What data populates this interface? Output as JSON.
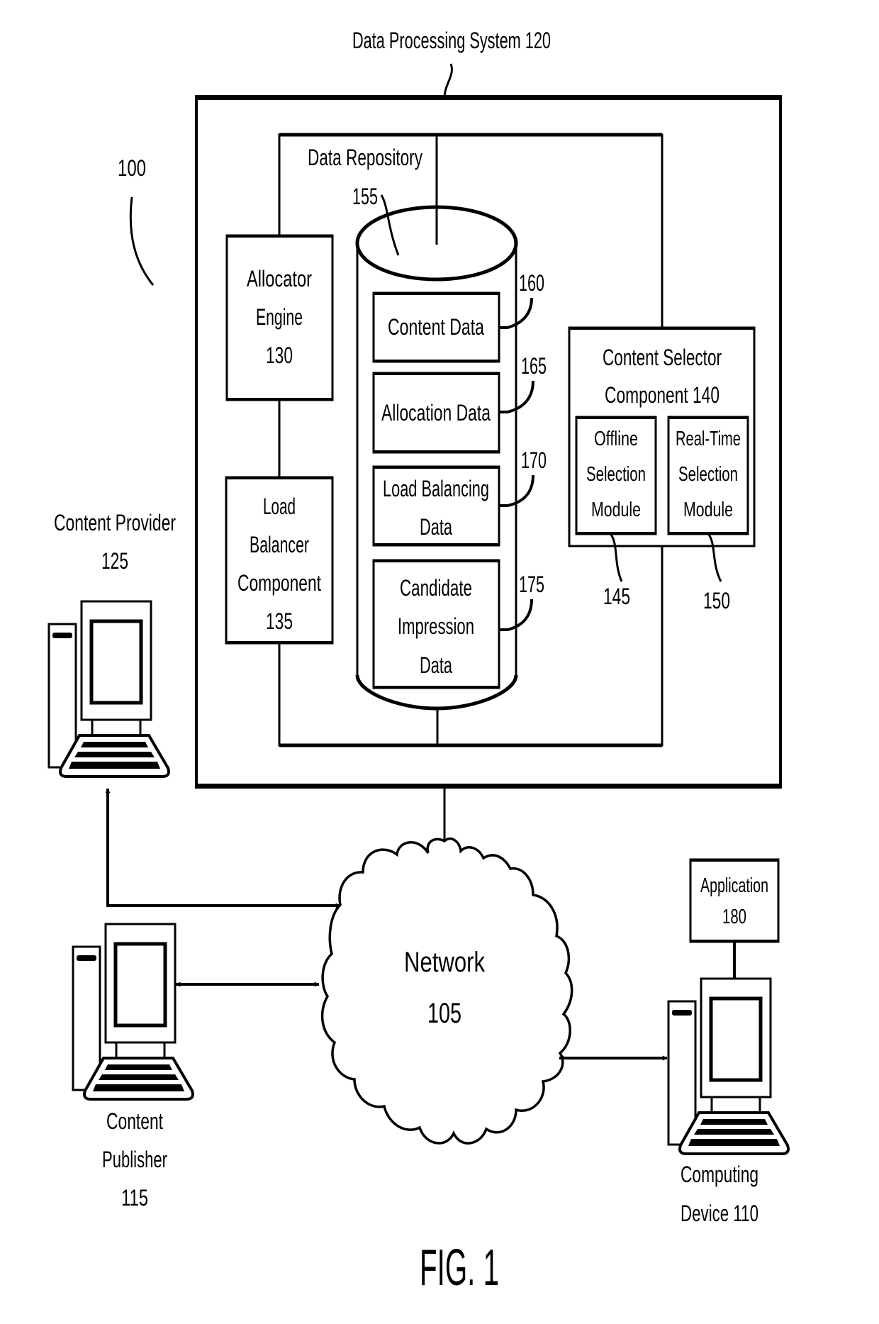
{
  "figure": {
    "label": "FIG. 1",
    "system_ref": "100"
  },
  "data_processing_system": {
    "title": "Data Processing System 120"
  },
  "data_repository": {
    "title": "Data Repository",
    "ref": "155",
    "items": [
      {
        "lines": [
          "Content Data"
        ],
        "ref": "160"
      },
      {
        "lines": [
          "Allocation Data"
        ],
        "ref": "165"
      },
      {
        "lines": [
          "Load Balancing",
          "Data"
        ],
        "ref": "170"
      },
      {
        "lines": [
          "Candidate",
          "Impression",
          "Data"
        ],
        "ref": "175"
      }
    ]
  },
  "allocator_engine": {
    "lines": [
      "Allocator",
      "Engine",
      "130"
    ]
  },
  "load_balancer": {
    "lines": [
      "Load",
      "Balancer",
      "Component",
      "135"
    ]
  },
  "content_selector": {
    "lines": [
      "Content Selector",
      "Component 140"
    ],
    "offline": {
      "lines": [
        "Offline",
        "Selection",
        "Module"
      ],
      "ref": "145"
    },
    "realtime": {
      "lines": [
        "Real-Time",
        "Selection",
        "Module"
      ],
      "ref": "150"
    }
  },
  "network": {
    "lines": [
      "Network",
      "105"
    ]
  },
  "content_provider": {
    "lines": [
      "Content Provider",
      "125"
    ]
  },
  "content_publisher": {
    "lines": [
      "Content",
      "Publisher",
      "115"
    ]
  },
  "computing_device": {
    "lines": [
      "Computing",
      "Device 110"
    ]
  },
  "application": {
    "lines": [
      "Application",
      "180"
    ]
  }
}
